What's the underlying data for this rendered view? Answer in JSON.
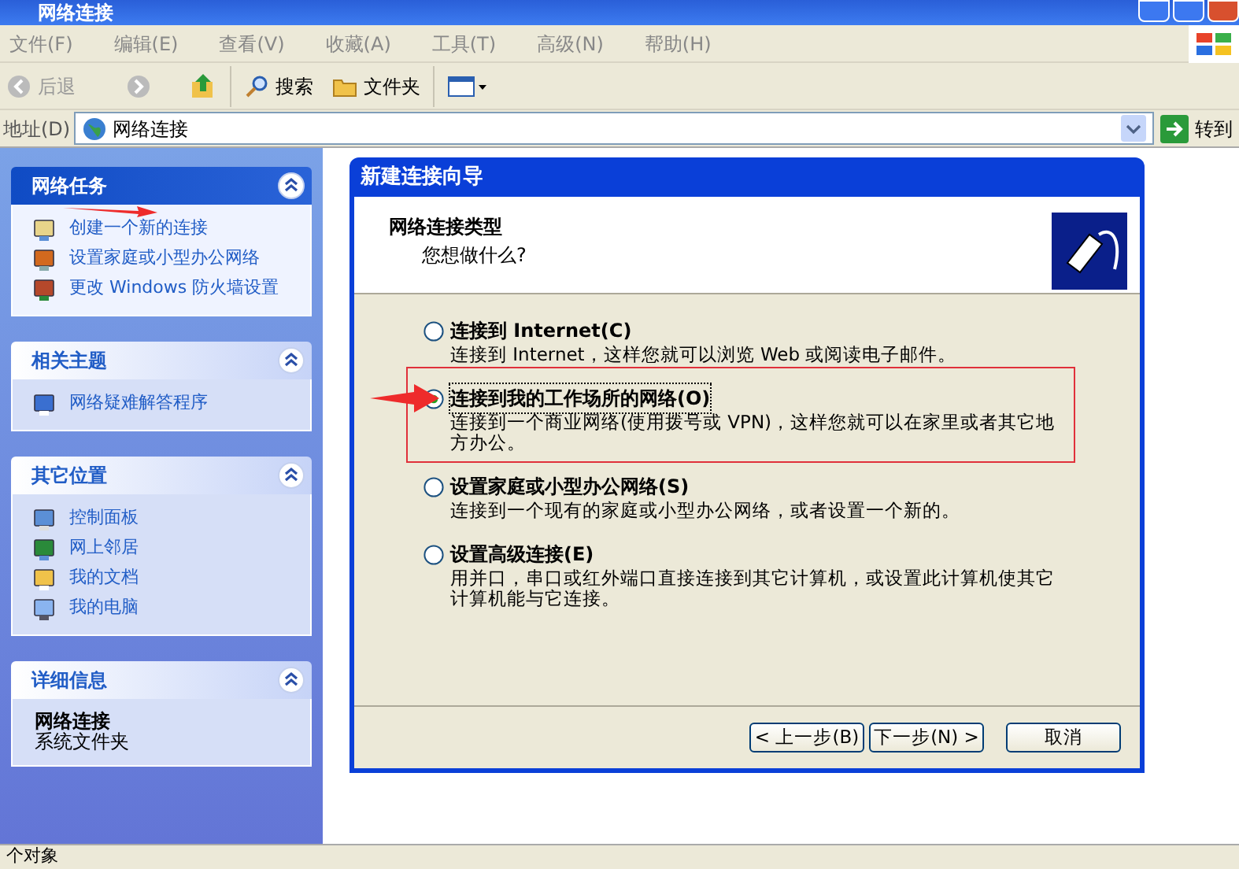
{
  "window": {
    "title": "网络连接"
  },
  "menu": [
    "文件(F)",
    "编辑(E)",
    "查看(V)",
    "收藏(A)",
    "工具(T)",
    "高级(N)",
    "帮助(H)"
  ],
  "toolbar": {
    "back": "后退",
    "search": "搜索",
    "folders": "文件夹"
  },
  "address": {
    "label": "地址(D)",
    "value": "网络连接",
    "go": "转到"
  },
  "sidebar": {
    "panels": [
      {
        "title": "网络任务",
        "expanded": true,
        "items": [
          "创建一个新的连接",
          "设置家庭或小型办公网络",
          "更改 Windows 防火墙设置"
        ]
      },
      {
        "title": "相关主题",
        "expanded": true,
        "items": [
          "网络疑难解答程序"
        ]
      },
      {
        "title": "其它位置",
        "expanded": true,
        "items": [
          "控制面板",
          "网上邻居",
          "我的文档",
          "我的电脑"
        ]
      }
    ],
    "details": {
      "title": "详细信息",
      "expanded": true,
      "name": "网络连接",
      "type": "系统文件夹"
    }
  },
  "dialog": {
    "title": "新建连接向导",
    "header_title": "网络连接类型",
    "header_subtitle": "您想做什么?",
    "options": [
      {
        "label": "连接到 Internet(C)",
        "description": "连接到 Internet，这样您就可以浏览 Web 或阅读电子邮件。",
        "selected": false
      },
      {
        "label": "连接到我的工作场所的网络(O)",
        "description": "连接到一个商业网络(使用拨号或 VPN)，这样您就可以在家里或者其它地方办公。",
        "selected": true
      },
      {
        "label": "设置家庭或小型办公网络(S)",
        "description": "连接到一个现有的家庭或小型办公网络，或者设置一个新的。",
        "selected": false
      },
      {
        "label": "设置高级连接(E)",
        "description": "用并口，串口或红外端口直接连接到其它计算机，或设置此计算机使其它计算机能与它连接。",
        "selected": false
      }
    ],
    "buttons": [
      "< 上一步(B)",
      "下一步(N) >",
      "取消"
    ]
  },
  "status_bar": "个对象"
}
